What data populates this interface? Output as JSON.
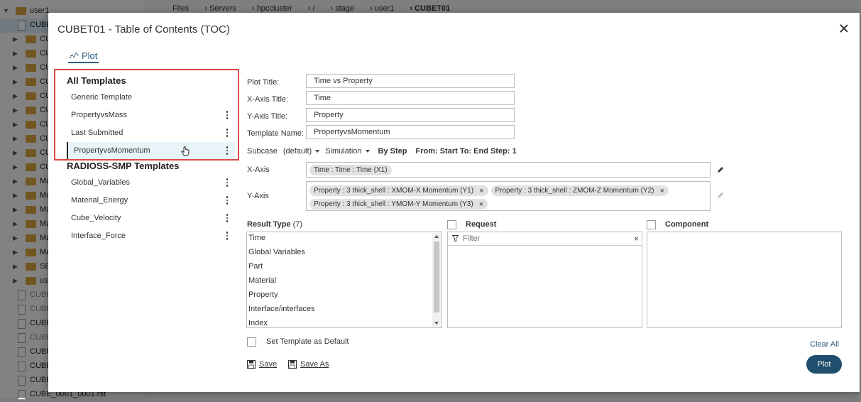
{
  "background": {
    "breadcrumb": [
      "Files",
      "Servers",
      "hpccluster",
      "/",
      "stage",
      "user1",
      "CUBET01"
    ],
    "tree": [
      {
        "label": "user1",
        "kind": "folder",
        "expanded": true
      },
      {
        "label": "CUBE",
        "kind": "file-highlight"
      },
      {
        "label": "CU",
        "kind": "folder"
      },
      {
        "label": "CU",
        "kind": "folder"
      },
      {
        "label": "CU",
        "kind": "folder"
      },
      {
        "label": "CU",
        "kind": "folder"
      },
      {
        "label": "CU",
        "kind": "folder"
      },
      {
        "label": "CU",
        "kind": "folder"
      },
      {
        "label": "CU",
        "kind": "folder"
      },
      {
        "label": "CU",
        "kind": "folder"
      },
      {
        "label": "CU",
        "kind": "folder"
      },
      {
        "label": "CU",
        "kind": "folder"
      },
      {
        "label": "Ma",
        "kind": "folder"
      },
      {
        "label": "Ma",
        "kind": "folder"
      },
      {
        "label": "Ma",
        "kind": "folder"
      },
      {
        "label": "Ma",
        "kind": "folder"
      },
      {
        "label": "Ma",
        "kind": "folder"
      },
      {
        "label": "Ma",
        "kind": "folder"
      },
      {
        "label": "SE",
        "kind": "folder"
      },
      {
        "label": "us",
        "kind": "folder"
      },
      {
        "label": "CUBE",
        "kind": "file-dim"
      },
      {
        "label": "CUBE",
        "kind": "file-dim"
      },
      {
        "label": "CUBE",
        "kind": "file"
      },
      {
        "label": "CUBE",
        "kind": "file-dim"
      },
      {
        "label": "CUBE",
        "kind": "file"
      },
      {
        "label": "CUBE",
        "kind": "file"
      },
      {
        "label": "CUBE",
        "kind": "file"
      },
      {
        "label": "CUBE_0001_0001.rst",
        "kind": "file"
      }
    ]
  },
  "modal": {
    "title": "CUBET01 - Table of Contents (TOC)",
    "tab_label": "Plot"
  },
  "templates": {
    "all_title": "All Templates",
    "all_items": [
      "Generic Template",
      "PropertyvsMass",
      "Last Submitted",
      "PropertyvsMomentum"
    ],
    "radioss_title": "RADIOSS-SMP Templates",
    "radioss_items": [
      "Global_Variables",
      "Material_Energy",
      "Cube_Velocity",
      "Interface_Force"
    ]
  },
  "form": {
    "plot_title_label": "Plot Title:",
    "plot_title_value": "Time vs Property",
    "x_axis_title_label": "X-Axis Title:",
    "x_axis_title_value": "Time",
    "y_axis_title_label": "Y-Axis Title:",
    "y_axis_title_value": "Property",
    "template_name_label": "Template Name:",
    "template_name_value": "PropertyvsMomentum"
  },
  "subcase": {
    "label": "Subcase",
    "subcase_value": "(default)",
    "simulation_value": "Simulation",
    "by_step": "By Step",
    "range": "From: Start To: End Step: 1"
  },
  "axes": {
    "x_label": "X-Axis",
    "x_chips": [
      "Time : Time : Time (X1)"
    ],
    "y_label": "Y-Axis",
    "y_chips": [
      "Property : 3 thick_shell : XMOM-X Momentum (Y1)",
      "Property : 3 thick_shell : ZMOM-Z Momentum (Y2)",
      "Property : 3 thick_shell : YMOM-Y Momentum (Y3)"
    ]
  },
  "result_type": {
    "title": "Result Type",
    "count": "(7)",
    "items": [
      "Time",
      "Global Variables",
      "Part",
      "Material",
      "Property",
      "Interface/interfaces",
      "Index"
    ]
  },
  "request": {
    "title": "Request",
    "filter_placeholder": "Filter"
  },
  "component": {
    "title": "Component"
  },
  "footer": {
    "set_default_label": "Set Template as Default",
    "save_label": "Save",
    "save_as_label": "Save As",
    "clear_all_label": "Clear All",
    "plot_label": "Plot"
  },
  "colors": {
    "accent": "#2a5d84",
    "primary_button": "#1f4e6e",
    "highlight_box": "#d94a4a",
    "selected_row": "#e8f4f8"
  }
}
